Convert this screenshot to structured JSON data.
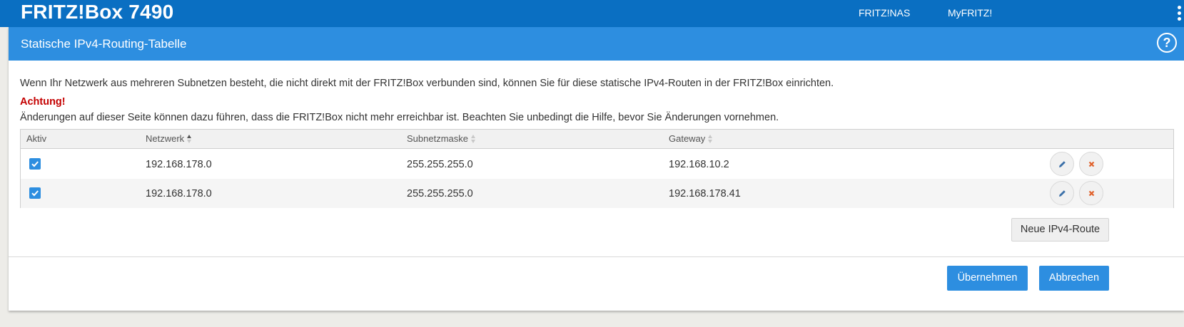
{
  "header": {
    "brand": "FRITZ!Box 7490",
    "links": [
      "FRITZ!NAS",
      "MyFRITZ!"
    ]
  },
  "page": {
    "title": "Statische IPv4-Routing-Tabelle",
    "help_label": "?",
    "intro": "Wenn Ihr Netzwerk aus mehreren Subnetzen besteht, die nicht direkt mit der FRITZ!Box verbunden sind, können Sie für diese statische IPv4-Routen in der FRITZ!Box einrichten.",
    "warning_title": "Achtung!",
    "warning_text": "Änderungen auf dieser Seite können dazu führen, dass die FRITZ!Box nicht mehr erreichbar ist. Beachten Sie unbedingt die Hilfe, bevor Sie Änderungen vornehmen."
  },
  "table": {
    "columns": [
      "Aktiv",
      "Netzwerk",
      "Subnetzmaske",
      "Gateway"
    ],
    "sort_column": "Netzwerk",
    "sort_direction": "ascending",
    "rows": [
      {
        "active": true,
        "network": "192.168.178.0",
        "subnet": "255.255.255.0",
        "gateway": "192.168.10.2"
      },
      {
        "active": true,
        "network": "192.168.178.0",
        "subnet": "255.255.255.0",
        "gateway": "192.168.178.41"
      }
    ],
    "row_icons": [
      "pencil-icon",
      "close-icon"
    ]
  },
  "buttons": {
    "new_route": "Neue IPv4-Route",
    "apply": "Übernehmen",
    "cancel": "Abbrechen"
  },
  "colors": {
    "header_bg": "#0a6fc2",
    "title_bar_bg": "#2d8ee0",
    "warning": "#c40000",
    "edit_icon": "#3a6fa8",
    "delete_icon": "#e0602a"
  }
}
